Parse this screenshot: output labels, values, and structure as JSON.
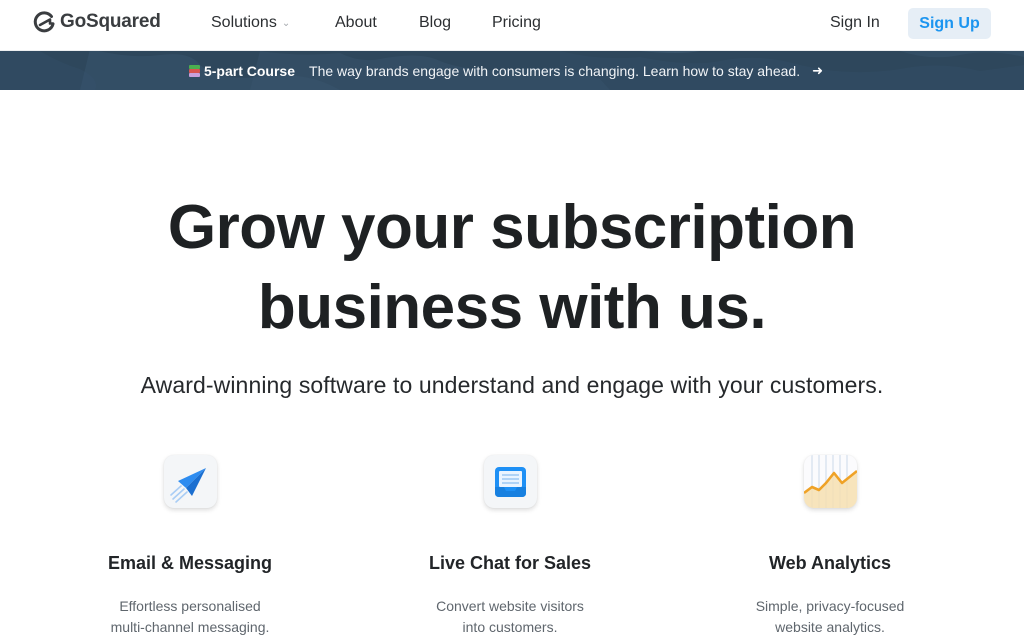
{
  "nav": {
    "brand": "GoSquared",
    "links": [
      {
        "label": "Solutions",
        "has_dropdown": true
      },
      {
        "label": "About"
      },
      {
        "label": "Blog"
      },
      {
        "label": "Pricing"
      }
    ],
    "sign_in": "Sign In",
    "sign_up": "Sign Up",
    "colors": {
      "accent": "#1c95f0",
      "signup_bg": "#e6eef6"
    }
  },
  "banner": {
    "icon": "books-icon",
    "tag": "5-part Course",
    "message": "The way brands engage with consumers is changing. Learn how to stay ahead.",
    "arrow": "➜",
    "background": "#2e475c"
  },
  "hero": {
    "title_line1": "Grow your subscription",
    "title_line2": "business with us.",
    "subtitle": "Award-winning software to understand and engage with your customers."
  },
  "features": [
    {
      "icon": "paper-plane-icon",
      "title": "Email & Messaging",
      "desc_line1": "Effortless personalised",
      "desc_line2": "multi-channel messaging."
    },
    {
      "icon": "inbox-tray-icon",
      "title": "Live Chat for Sales",
      "desc_line1": "Convert website visitors",
      "desc_line2": "into customers."
    },
    {
      "icon": "analytics-chart-icon",
      "title": "Web Analytics",
      "desc_line1": "Simple, privacy-focused",
      "desc_line2": "website analytics."
    }
  ]
}
